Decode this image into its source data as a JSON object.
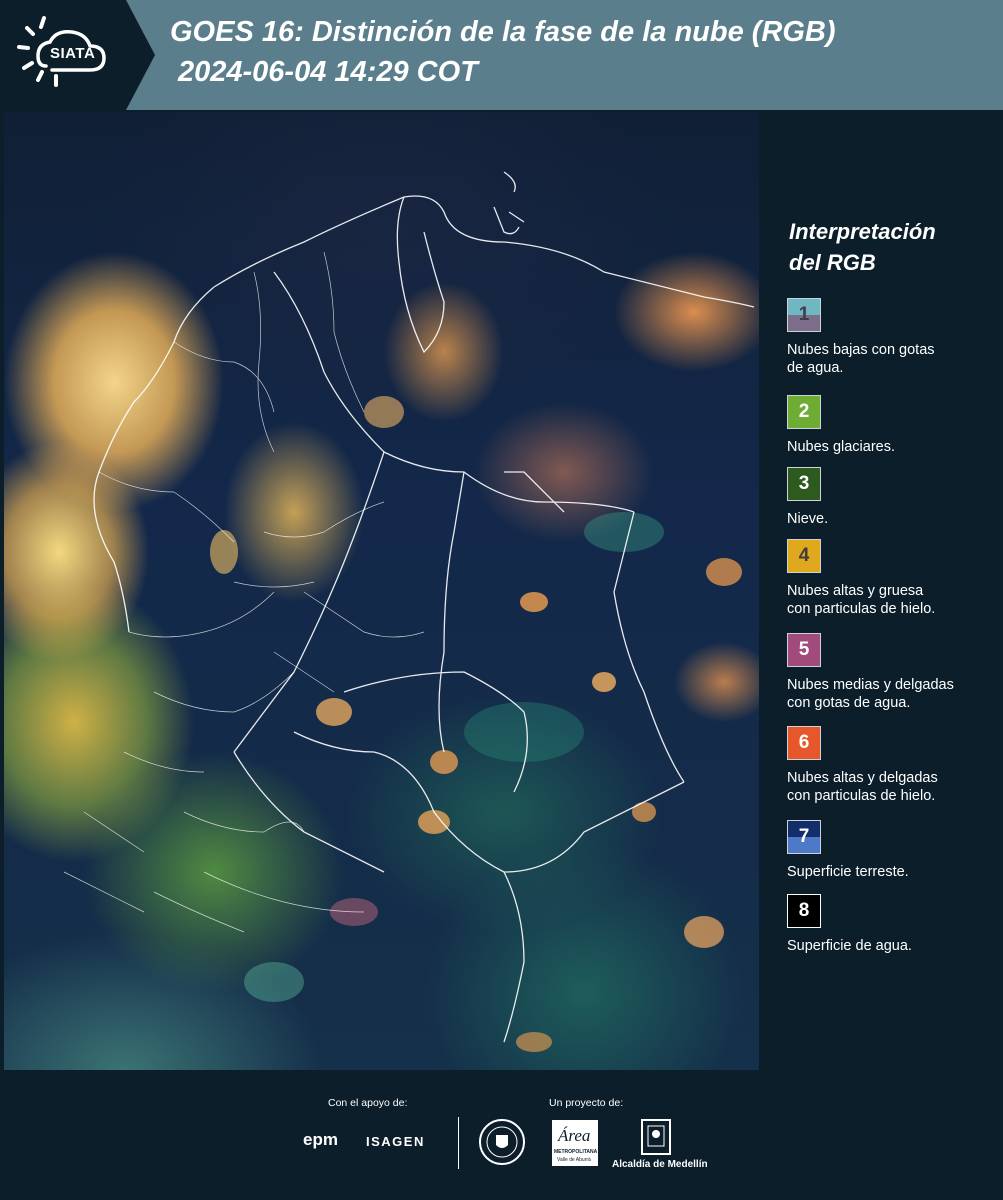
{
  "header": {
    "logo_text": "SIATA",
    "title_line1": "GOES 16: Distinción de la fase de la nube (RGB)",
    "title_line2": "2024-06-04 14:29 COT"
  },
  "legend": {
    "title_line1": "Interpretación",
    "title_line2": "del RGB",
    "items": [
      {
        "number": "1",
        "label_line1": "Nubes bajas con gotas",
        "label_line2": "de agua.",
        "color_top": "#6fb7c3",
        "color_bottom": "#7d6f8c",
        "text_color": "#3d3d4a"
      },
      {
        "number": "2",
        "label_line1": "Nubes glaciares.",
        "label_line2": "",
        "color_top": "#6eac36",
        "color_bottom": "#6eac36",
        "text_color": "#ffffff"
      },
      {
        "number": "3",
        "label_line1": "Nieve.",
        "label_line2": "",
        "color_top": "#2d5a1f",
        "color_bottom": "#2d5a1f",
        "text_color": "#ffffff"
      },
      {
        "number": "4",
        "label_line1": "Nubes altas y gruesa",
        "label_line2": "con particulas de hielo.",
        "color_top": "#e0a81c",
        "color_bottom": "#e0a81c",
        "text_color": "#3d3d3d"
      },
      {
        "number": "5",
        "label_line1": "Nubes medias y delgadas",
        "label_line2": "con gotas de agua.",
        "color_top": "#a04b7c",
        "color_bottom": "#a04b7c",
        "text_color": "#ffffff"
      },
      {
        "number": "6",
        "label_line1": "Nubes altas y delgadas",
        "label_line2": "con particulas de hielo.",
        "color_top": "#e6572b",
        "color_bottom": "#e6572b",
        "text_color": "#ffffff"
      },
      {
        "number": "7",
        "label_line1": "Superficie terreste.",
        "label_line2": "",
        "color_top": "#132e6a",
        "color_bottom": "#4e79c9",
        "text_color": "#ffffff"
      },
      {
        "number": "8",
        "label_line1": "Superficie de agua.",
        "label_line2": "",
        "color_top": "#000000",
        "color_bottom": "#000000",
        "text_color": "#ffffff"
      }
    ]
  },
  "footer": {
    "support_label": "Con el apoyo de:",
    "project_label": "Un proyecto de:",
    "sponsor_epm": "epm",
    "sponsor_isagen": "ISAGEN",
    "area_logo_text": "Área",
    "area_logo_sub1": "METROPOLITANA",
    "area_logo_sub2": "Valle de Aburrá",
    "alcaldia_label": "Alcaldía de Medellín"
  },
  "colors": {
    "header_bg": "#5b7e8c",
    "page_bg": "#0b1e2a"
  }
}
